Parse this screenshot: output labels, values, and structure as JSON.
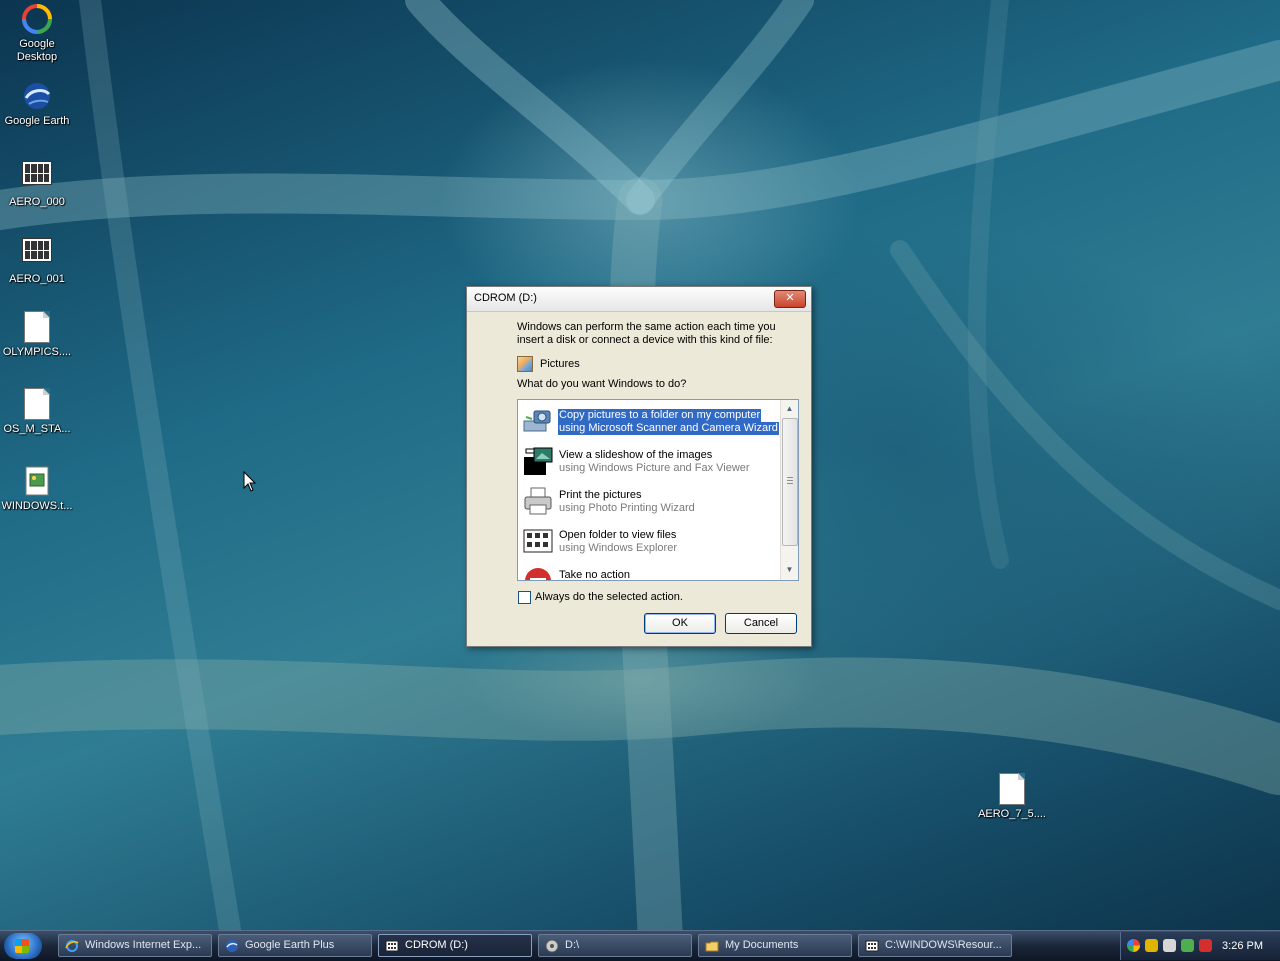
{
  "desktop": {
    "icons": [
      {
        "label": "Google\nDesktop",
        "l1": "Google",
        "l2": "Desktop"
      },
      {
        "label": "Google Earth"
      },
      {
        "label": "AERO_000"
      },
      {
        "label": "AERO_001"
      },
      {
        "label": "OLYMPICS...."
      },
      {
        "label": "OS_M_STA..."
      },
      {
        "label": "WINDOWS.t..."
      },
      {
        "label": "AERO_7_5...."
      }
    ]
  },
  "dialog": {
    "title": "CDROM (D:)",
    "close_label": "✕",
    "intro": "Windows can perform the same action each time you insert a disk or connect a device with this kind of file:",
    "content_type": "Pictures",
    "question": "What do you want Windows to do?",
    "actions": [
      {
        "title": "Copy pictures to a folder on my computer",
        "sub": "using Microsoft Scanner and Camera Wizard",
        "icon": "camera-scanner-icon",
        "selected": true
      },
      {
        "title": "View a slideshow of the images",
        "sub": "using Windows Picture and Fax Viewer",
        "icon": "slideshow-icon"
      },
      {
        "title": "Print the pictures",
        "sub": "using Photo Printing Wizard",
        "icon": "printer-icon"
      },
      {
        "title": "Open folder to view files",
        "sub": "using Windows Explorer",
        "icon": "folder-view-icon"
      },
      {
        "title": "Take no action",
        "sub": "",
        "icon": "no-action-icon"
      }
    ],
    "always_label": "Always do the selected action.",
    "always_checked": false,
    "ok_label": "OK",
    "cancel_label": "Cancel"
  },
  "taskbar": {
    "tasks": [
      {
        "label": "Windows Internet Exp...",
        "icon": "ie-icon"
      },
      {
        "label": "Google Earth Plus",
        "icon": "google-earth-icon"
      },
      {
        "label": "CDROM (D:)",
        "icon": "cdrom-icon",
        "active": true
      },
      {
        "label": "D:\\",
        "icon": "drive-icon"
      },
      {
        "label": "My Documents",
        "icon": "folder-icon"
      },
      {
        "label": "C:\\WINDOWS\\Resour...",
        "icon": "folder-grid-icon"
      }
    ],
    "clock": "3:26 PM"
  },
  "colors": {
    "selection": "#316ac5",
    "dialog_bg": "#ece9d8",
    "taskbar": "#1a2638"
  }
}
